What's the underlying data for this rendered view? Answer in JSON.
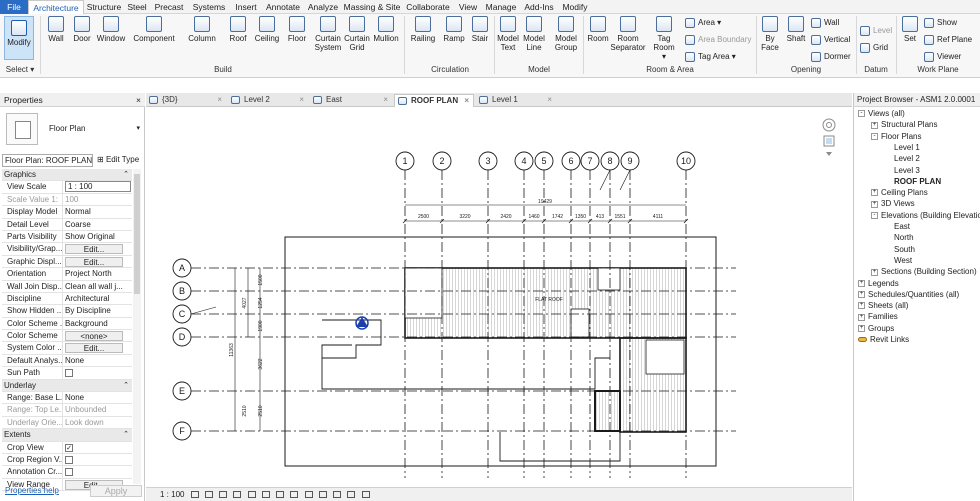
{
  "menubar": {
    "tabs": [
      "File",
      "Architecture",
      "Structure",
      "Steel",
      "Precast",
      "Systems",
      "Insert",
      "Annotate",
      "Analyze",
      "Massing & Site",
      "Collaborate",
      "View",
      "Manage",
      "Add-Ins",
      "Modify"
    ],
    "active": "Architecture",
    "file_color": "#2b6cc4"
  },
  "ribbon": {
    "select": {
      "modify": "Modify",
      "label": "Select"
    },
    "build": {
      "label": "Build",
      "wall": "Wall",
      "door": "Door",
      "window": "Window",
      "component": "Component",
      "column": "Column",
      "roof": "Roof",
      "ceiling": "Ceiling",
      "floor": "Floor",
      "curtain_system_1": "Curtain",
      "curtain_system_2": "System",
      "curtain_grid_1": "Curtain",
      "curtain_grid_2": "Grid",
      "mullion": "Mullion"
    },
    "circulation": {
      "label": "Circulation",
      "railing": "Railing",
      "ramp": "Ramp",
      "stair": "Stair"
    },
    "model": {
      "label": "Model",
      "model_text_1": "Model",
      "model_text_2": "Text",
      "model_line_1": "Model",
      "model_line_2": "Line",
      "model_group_1": "Model",
      "model_group_2": "Group"
    },
    "room_area": {
      "label": "Room & Area",
      "room": "Room",
      "room_sep_1": "Room",
      "room_sep_2": "Separator",
      "tag_room_1": "Tag",
      "tag_room_2": "Room",
      "area": "Area",
      "area_boundary": "Area Boundary",
      "tag_area": "Tag Area"
    },
    "opening": {
      "label": "Opening",
      "by_face_1": "By",
      "by_face_2": "Face",
      "shaft": "Shaft",
      "wall": "Wall",
      "vertical": "Vertical",
      "dormer": "Dormer"
    },
    "datum": {
      "label": "Datum",
      "level": "Level",
      "grid": "Grid"
    },
    "work_plane": {
      "label": "Work Plane",
      "set": "Set",
      "show": "Show",
      "ref_plane": "Ref  Plane",
      "viewer": "Viewer"
    }
  },
  "properties": {
    "title": "Properties",
    "close": "×",
    "type_name": "Floor Plan",
    "selector": "Floor Plan: ROOF PLAN",
    "edit_type": "Edit Type",
    "rows": [
      {
        "group": "Graphics"
      },
      {
        "k": "View Scale",
        "v": "1 : 100",
        "boxed": true
      },
      {
        "k": "Scale Value    1:",
        "v": "100",
        "dim": true
      },
      {
        "k": "Display Model",
        "v": "Normal"
      },
      {
        "k": "Detail Level",
        "v": "Coarse"
      },
      {
        "k": "Parts Visibility",
        "v": "Show Original"
      },
      {
        "k": "Visibility/Grap...",
        "v": "Edit...",
        "button": true
      },
      {
        "k": "Graphic Displ...",
        "v": "Edit...",
        "button": true
      },
      {
        "k": "Orientation",
        "v": "Project North"
      },
      {
        "k": "Wall Join Disp...",
        "v": "Clean all wall j..."
      },
      {
        "k": "Discipline",
        "v": "Architectural"
      },
      {
        "k": "Show Hidden ...",
        "v": "By Discipline"
      },
      {
        "k": "Color Scheme ...",
        "v": "Background"
      },
      {
        "k": "Color Scheme",
        "v": "<none>",
        "button": true
      },
      {
        "k": "System Color ...",
        "v": "Edit...",
        "button": true
      },
      {
        "k": "Default Analys...",
        "v": "None"
      },
      {
        "k": "Sun Path",
        "v": "",
        "checkbox": false
      },
      {
        "group": "Underlay"
      },
      {
        "k": "Range: Base L...",
        "v": "None"
      },
      {
        "k": "Range: Top Le...",
        "v": "Unbounded",
        "dim": true
      },
      {
        "k": "Underlay Orie...",
        "v": "Look down",
        "dim": true
      },
      {
        "group": "Extents"
      },
      {
        "k": "Crop View",
        "v": "",
        "checkbox": true
      },
      {
        "k": "Crop Region V...",
        "v": "",
        "checkbox": false
      },
      {
        "k": "Annotation Cr...",
        "v": "",
        "checkbox": false
      },
      {
        "k": "View Range",
        "v": "Edit...",
        "button": true
      }
    ],
    "help": "Properties help",
    "apply": "Apply"
  },
  "view_tabs": [
    {
      "label": "{3D}",
      "active": false
    },
    {
      "label": "Level 2",
      "active": false
    },
    {
      "label": "East",
      "active": false
    },
    {
      "label": "ROOF PLAN",
      "active": true
    },
    {
      "label": "Level 1",
      "active": false
    }
  ],
  "drawing": {
    "grid_columns": [
      "1",
      "2",
      "3",
      "4",
      "5",
      "6",
      "7",
      "8",
      "9",
      "10"
    ],
    "grid_rows": [
      "A",
      "B",
      "C",
      "D",
      "E",
      "F"
    ],
    "overall_dim": "19429",
    "col_dims": [
      "2500",
      "3220",
      "2420",
      "1460",
      "1742",
      "1350",
      "413",
      "1551",
      "4111"
    ],
    "row_dims": [
      "1500",
      "1254",
      "1900",
      "3622",
      "2510"
    ],
    "row_dims_total": [
      "4027",
      "11363",
      "2510"
    ],
    "roof_label": "FLAT ROOF",
    "line_color": "#1a1a1a",
    "marker_color": "#1c3fb0"
  },
  "status": {
    "scale": "1 : 100"
  },
  "browser": {
    "title": "Project Browser - ASM1 2.0.0001",
    "close": "×",
    "nodes": [
      {
        "label": "Views (all)",
        "level": 0,
        "exp": "-"
      },
      {
        "label": "Structural Plans",
        "level": 1,
        "exp": "+"
      },
      {
        "label": "Floor Plans",
        "level": 1,
        "exp": "-"
      },
      {
        "label": "Level 1",
        "level": 2
      },
      {
        "label": "Level 2",
        "level": 2
      },
      {
        "label": "Level 3",
        "level": 2
      },
      {
        "label": "ROOF PLAN",
        "level": 2,
        "bold": true
      },
      {
        "label": "Ceiling Plans",
        "level": 1,
        "exp": "+"
      },
      {
        "label": "3D Views",
        "level": 1,
        "exp": "+"
      },
      {
        "label": "Elevations (Building Elevation)",
        "level": 1,
        "exp": "-"
      },
      {
        "label": "East",
        "level": 2
      },
      {
        "label": "North",
        "level": 2
      },
      {
        "label": "South",
        "level": 2
      },
      {
        "label": "West",
        "level": 2
      },
      {
        "label": "Sections (Building Section)",
        "level": 1,
        "exp": "+"
      },
      {
        "label": "Legends",
        "level": 0,
        "exp": "+"
      },
      {
        "label": "Schedules/Quantities (all)",
        "level": 0,
        "exp": "+"
      },
      {
        "label": "Sheets (all)",
        "level": 0,
        "exp": "+"
      },
      {
        "label": "Families",
        "level": 0,
        "exp": "+"
      },
      {
        "label": "Groups",
        "level": 0,
        "exp": "+"
      },
      {
        "label": "Revit Links",
        "level": 0,
        "link": true
      }
    ]
  }
}
